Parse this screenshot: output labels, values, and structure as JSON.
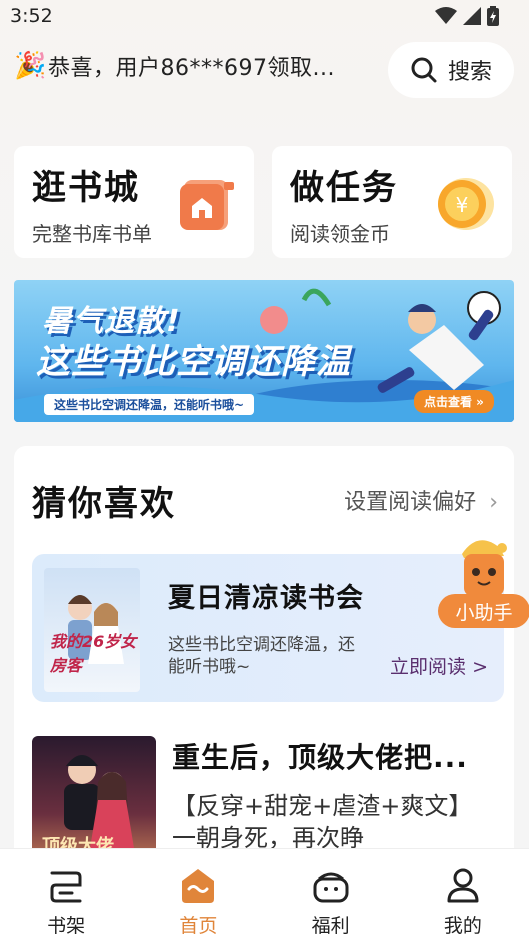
{
  "status_bar": {
    "time": "3:52"
  },
  "notice": {
    "text": "恭喜，用户86***697领取..."
  },
  "search": {
    "label": "搜索"
  },
  "cards": [
    {
      "title": "逛书城",
      "subtitle": "完整书库书单",
      "icon": "shop-icon"
    },
    {
      "title": "做任务",
      "subtitle": "阅读领金币",
      "icon": "coin-icon"
    }
  ],
  "banner": {
    "title_line1": "暑气退散!",
    "title_line2": "这些书比空调还降温",
    "subtitle": "这些书比空调还降温，还能听书哦~",
    "button": "点击查看 »"
  },
  "recommend": {
    "heading": "猜你喜欢",
    "preference_link": "设置阅读偏好",
    "promo": {
      "title": "夏日清凉读书会",
      "description": "这些书比空调还降温，还能听书哦~",
      "read_link": "立即阅读 >",
      "cover_text": "我的26岁女房客"
    },
    "helper_label": "小助手",
    "book": {
      "title": "重生后，顶级大佬把...",
      "description": "【反穿+甜宠+虐渣+爽文】一朝身死，再次睁",
      "cover_text": "顶级大佬"
    }
  },
  "tabs": [
    {
      "label": "书架",
      "icon": "bookshelf-icon",
      "active": false
    },
    {
      "label": "首页",
      "icon": "home-icon",
      "active": true
    },
    {
      "label": "福利",
      "icon": "gift-icon",
      "active": false
    },
    {
      "label": "我的",
      "icon": "profile-icon",
      "active": false
    }
  ],
  "colors": {
    "accent": "#e0853a",
    "background": "#f5f5f5"
  }
}
